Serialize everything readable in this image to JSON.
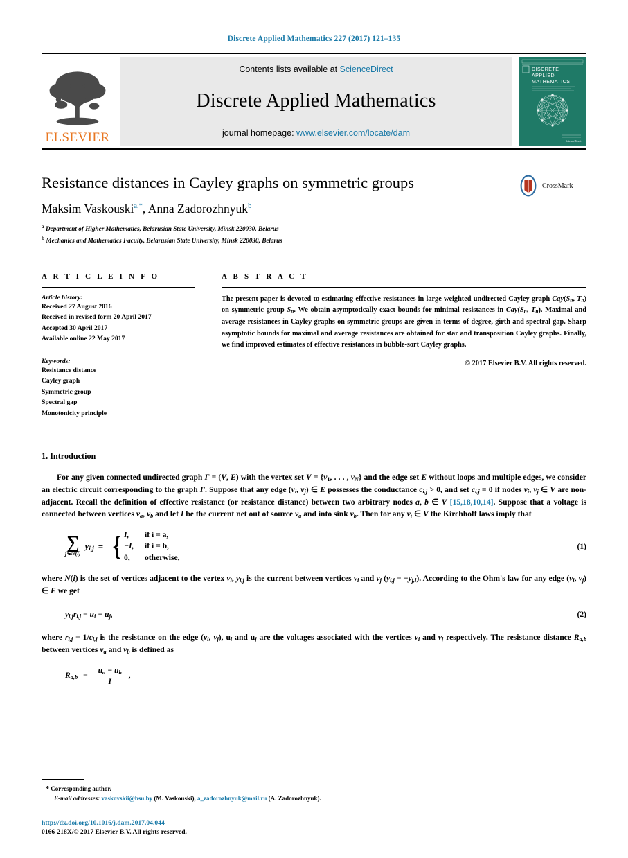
{
  "running_head": "Discrete Applied Mathematics 227 (2017) 121–135",
  "masthead": {
    "contents_prefix": "Contents lists available at",
    "sciencedirect": "ScienceDirect",
    "journal_name": "Discrete Applied Mathematics",
    "homepage_prefix": "journal homepage:",
    "homepage_url": "www.elsevier.com/locate/dam",
    "publisher_wordmark": "ELSEVIER",
    "cover_title_lines": [
      "DISCRETE",
      "APPLIED",
      "MATHEMATICS"
    ],
    "cover_color": "#1f7a67",
    "accent_color": "#1a7aa8",
    "elsevier_orange": "#e87722"
  },
  "article": {
    "title": "Resistance distances in Cayley graphs on symmetric groups",
    "authors_plain": "Maksim Vaskouski, Anna Zadorozhnyuk",
    "author1": "Maksim Vaskouski",
    "author1_sup": "a,*",
    "author2": "Anna Zadorozhnyuk",
    "author2_sup": "b",
    "affiliation_a": "Department of Higher Mathematics, Belarusian State University, Minsk 220030, Belarus",
    "affiliation_b": "Mechanics and Mathematics Faculty, Belarusian State University, Minsk 220030, Belarus",
    "crossmark_label": "CrossMark"
  },
  "article_info": {
    "heading": "A R T I C L E   I N F O",
    "history_label": "Article history:",
    "history": [
      "Received 27 August 2016",
      "Received in revised form 20 April 2017",
      "Accepted 30 April 2017",
      "Available online 22 May 2017"
    ],
    "keywords_label": "Keywords:",
    "keywords": [
      "Resistance distance",
      "Cayley graph",
      "Symmetric group",
      "Spectral gap",
      "Monotonicity principle"
    ]
  },
  "abstract": {
    "heading": "A B S T R A C T",
    "text": "The present paper is devoted to estimating effective resistances in large weighted undirected Cayley graph Cay(Sn, Tn) on symmetric group Sn. We obtain asymptotically exact bounds for minimal resistances in Cay(Sn, Tn). Maximal and average resistances in Cayley graphs on symmetric groups are given in terms of degree, girth and spectral gap. Sharp asymptotic bounds for maximal and average resistances are obtained for star and transposition Cayley graphs. Finally, we find improved estimates of effective resistances in bubble-sort Cayley graphs.",
    "copyright": "© 2017 Elsevier B.V. All rights reserved."
  },
  "body": {
    "section_number_title": "1. Introduction",
    "para1_a": "For any given connected undirected graph ",
    "para1_b": " = (V, E) with the vertex set V = {v1, . . . , vN} and the edge set E without loops and multiple edges, we consider an electric circuit corresponding to the graph ",
    "para1_c": ". Suppose that any edge (vi, vj) ∈ E possesses the conductance ci,j > 0, and set ci,j = 0 if nodes vi, vj ∈ V are non-adjacent. Recall the definition of effective resistance (or resistance distance) between two arbitrary nodes a, b ∈ V ",
    "citation": "[15,18,10,14]",
    "para1_d": ". Suppose that a voltage is connected between vertices va, vb and let I be the current net out of source va and into sink vb. Then for any vi ∈ V the Kirchhoff laws imply that",
    "eq1": {
      "number": "(1)",
      "sum_symbol": "∑",
      "sum_subscript": "j∈N(i)",
      "lhs_term": "yi,j",
      "equals": "=",
      "case1_value": "I,",
      "case1_cond": "if i = a,",
      "case2_value": "−I,",
      "case2_cond": "if i = b,",
      "case3_value": "0,",
      "case3_cond": "otherwise,"
    },
    "para2": "where N(i) is the set of vertices adjacent to the vertex vi, yi,j is the current between vertices vi and vj (yi,j = −yj,i). According to the Ohm's law for any edge (vi, vj) ∈ E we get",
    "eq2": {
      "number": "(2)",
      "expr": "yi,jri,j = ui − uj,"
    },
    "para3": "where ri,j = 1/ci,j is the resistance on the edge (vi, vj), ui and uj are the voltages associated with the vertices vi and vj respectively. The resistance distance Ra,b between vertices va and vb is defined as",
    "eq3": {
      "lhs": "Ra,b",
      "equals": "=",
      "numerator": "ua − ub",
      "denominator": "I",
      "trailing": ","
    }
  },
  "footnotes": {
    "corresponding": "Corresponding author.",
    "star": "*",
    "email_label": "E-mail addresses:",
    "email1": "vaskovskii@bsu.by",
    "email1_owner": "(M. Vaskouski),",
    "email2": "a_zadorozhnyuk@mail.ru",
    "email2_owner": "(A. Zadorozhnyuk).",
    "doi": "http://dx.doi.org/10.1016/j.dam.2017.04.044",
    "issn": "0166-218X/© 2017 Elsevier B.V. All rights reserved."
  }
}
